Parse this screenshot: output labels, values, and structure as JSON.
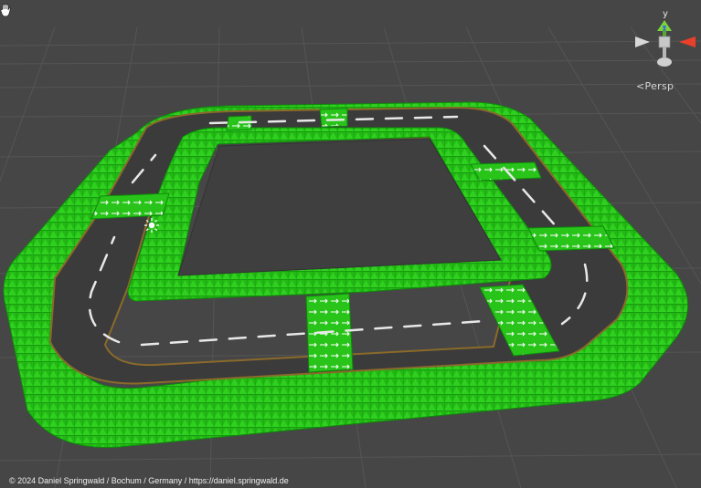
{
  "viewport": {
    "projection_label": "Persp",
    "gizmo_axis_y": "y",
    "background_color": "#464646",
    "grid_color": "#555555"
  },
  "track": {
    "navmesh_color": "#22b814",
    "navmesh_edge_color": "#0e8a0a",
    "road_color": "#3b3b3b",
    "curb_color": "#8a6a2a",
    "lane_marking_color": "#e8e8e8"
  },
  "icons": {
    "tool": "hand-icon",
    "light": "sun-icon",
    "gizmo": "scene-orientation-gizmo"
  },
  "footer": {
    "copyright": "© 2024 Daniel Springwald / Bochum / Germany / https://daniel.springwald.de"
  }
}
